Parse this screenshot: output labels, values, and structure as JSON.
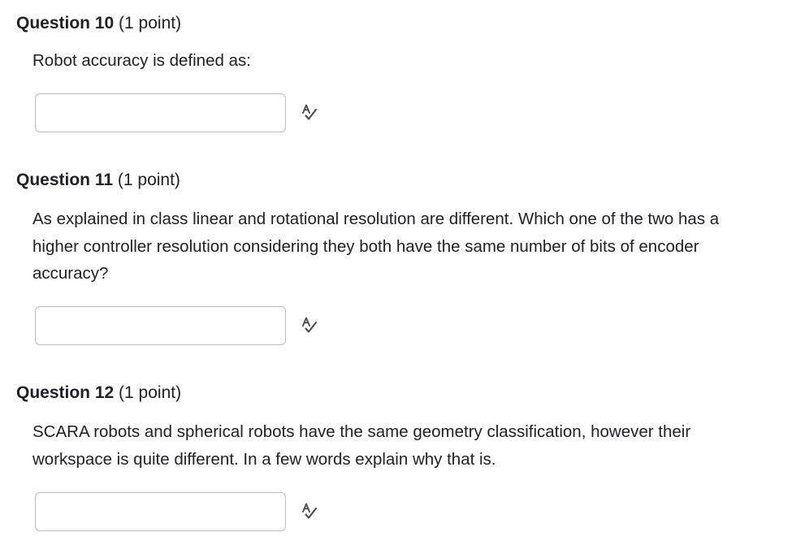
{
  "questions": [
    {
      "title": "Question 10",
      "points": "(1 point)",
      "prompt": "Robot accuracy is defined as:",
      "answer_value": "",
      "spellcheck_icon": "spellcheck-icon"
    },
    {
      "title": "Question 11",
      "points": "(1 point)",
      "prompt": "As explained in class linear and rotational resolution are different. Which one of the two has a higher controller resolution considering they both have the same number of bits of encoder accuracy?",
      "answer_value": "",
      "spellcheck_icon": "spellcheck-icon"
    },
    {
      "title": "Question 12",
      "points": "(1 point)",
      "prompt": "SCARA robots and spherical robots have the same geometry classification, however their workspace is quite different. In a few words explain why that is.",
      "answer_value": "",
      "spellcheck_icon": "spellcheck-icon"
    }
  ],
  "colors": {
    "text": "#202122",
    "input_border": "#b9bcc1",
    "icon": "#494c4e"
  }
}
